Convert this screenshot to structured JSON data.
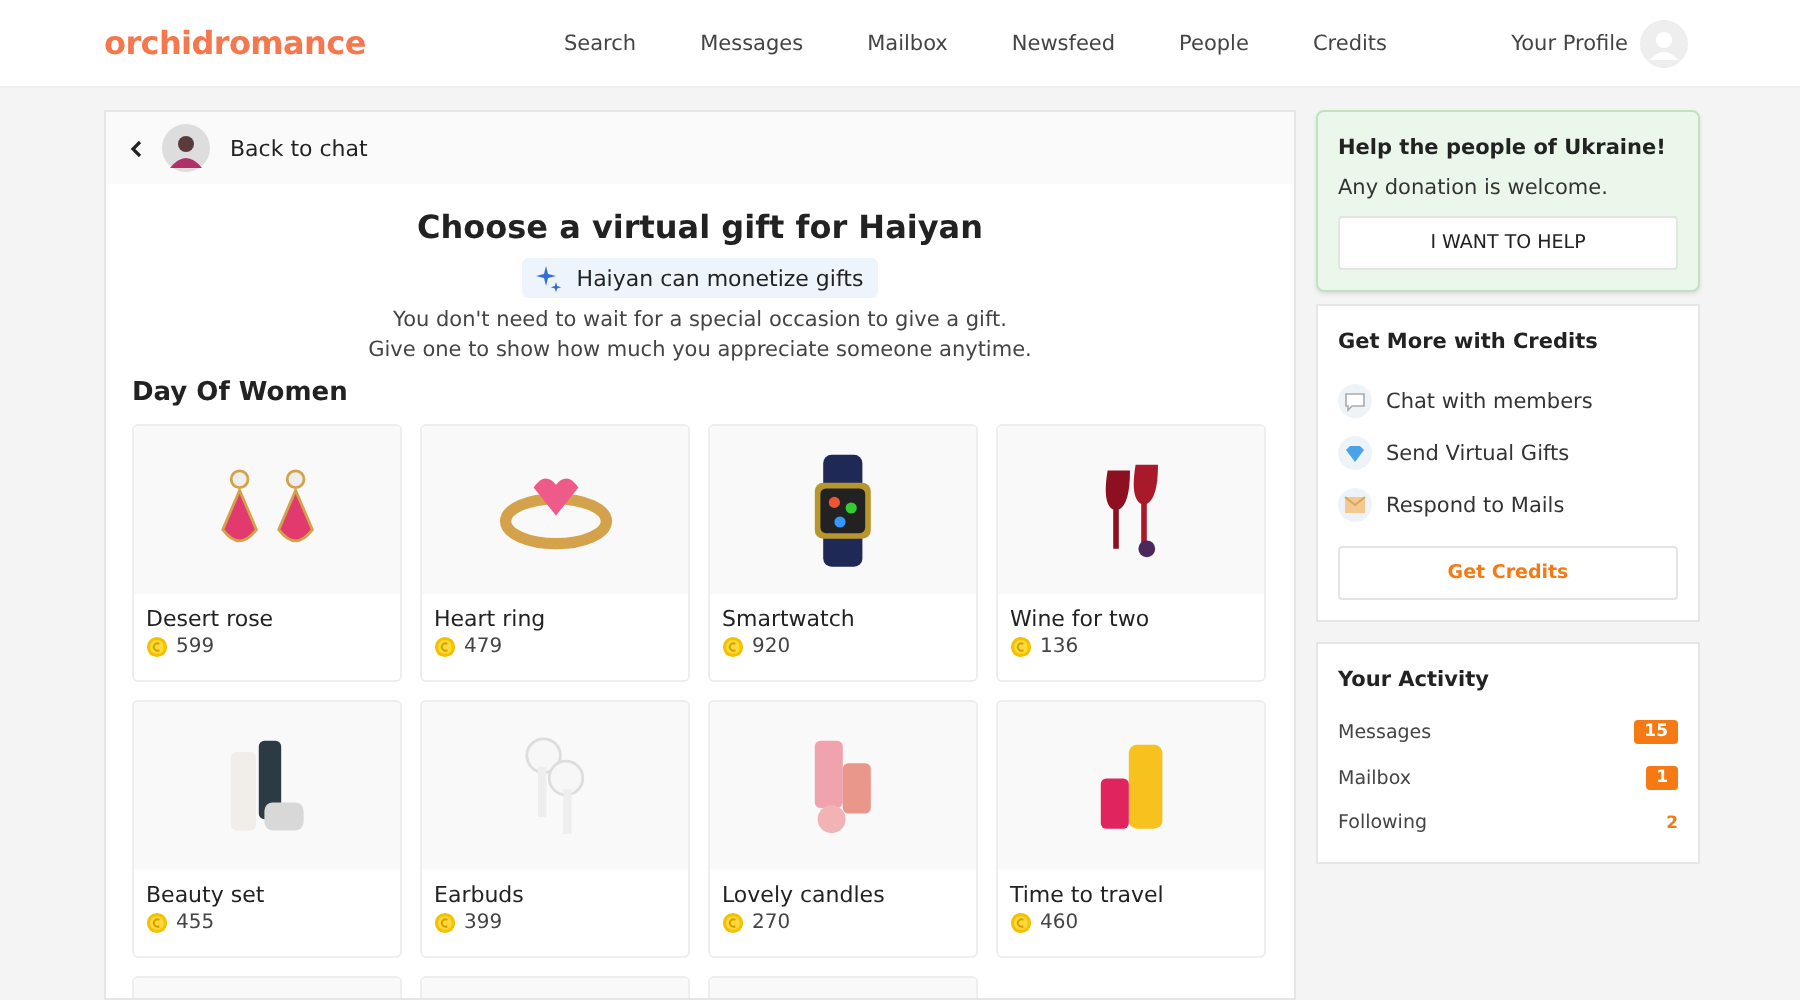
{
  "header": {
    "logo": "orchidromance",
    "nav": [
      {
        "label": "Search",
        "selected": false
      },
      {
        "label": "Messages",
        "selected": false
      },
      {
        "label": "Mailbox",
        "selected": false
      },
      {
        "label": "Newsfeed",
        "selected": false
      },
      {
        "label": "People",
        "selected": false
      },
      {
        "label": "Credits",
        "selected": false
      }
    ],
    "profile": "Your Profile"
  },
  "back_bar": {
    "label": "Back to chat"
  },
  "gift_panel": {
    "title": "Choose a virtual gift for Haiyan",
    "monetize_badge": "Haiyan can monetize gifts",
    "intro": [
      "You don't need to wait for a special occasion to give a gift.",
      "Give one to show how much you appreciate someone anytime."
    ],
    "section": "Day Of Women",
    "gifts": [
      {
        "name": "Desert rose",
        "price": "599"
      },
      {
        "name": "Heart ring",
        "price": "479"
      },
      {
        "name": "Smartwatch",
        "price": "920"
      },
      {
        "name": "Wine for two",
        "price": "136"
      },
      {
        "name": "Beauty set",
        "price": "455"
      },
      {
        "name": "Earbuds",
        "price": "399"
      },
      {
        "name": "Lovely candles",
        "price": "270"
      },
      {
        "name": "Time to travel",
        "price": "460"
      }
    ],
    "partial_cards": [
      {
        "kind": "picture"
      },
      {
        "kind": "picture"
      },
      {
        "kind": "picture"
      }
    ]
  },
  "ukraine_card": {
    "title": "Help the people of Ukraine!",
    "text": "Any donation is welcome.",
    "button": "I WANT TO HELP"
  },
  "credits_card": {
    "title": "Get More with Credits",
    "features": [
      {
        "kind": "chat",
        "label": "Chat with members"
      },
      {
        "kind": "gift",
        "label": "Send Virtual Gifts"
      },
      {
        "kind": "mail",
        "label": "Respond to Mails"
      }
    ],
    "button": "Get Credits"
  },
  "activity_card": {
    "title": "Your Activity",
    "items": [
      {
        "label": "Messages",
        "count": "15",
        "kind": "badge"
      },
      {
        "label": "Mailbox",
        "count": "1",
        "kind": "badge"
      },
      {
        "label": "Following",
        "count": "2",
        "kind": "plain"
      }
    ]
  }
}
